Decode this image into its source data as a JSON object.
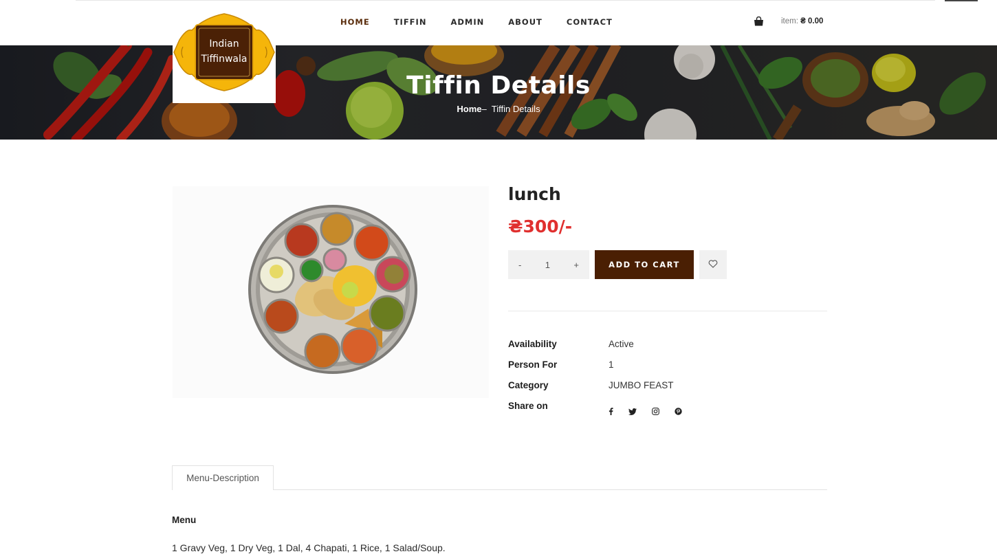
{
  "nav": {
    "items": [
      {
        "label": "HOME"
      },
      {
        "label": "TIFFIN"
      },
      {
        "label": "ADMIN"
      },
      {
        "label": "ABOUT"
      },
      {
        "label": "CONTACT"
      }
    ]
  },
  "cart": {
    "item_label": "item:",
    "amount": "₴ 0.00",
    "icon": "shopping-bag-icon"
  },
  "logo": {
    "line1": "Indian",
    "line2": "Tiffinwala"
  },
  "banner": {
    "title": "Tiffin Details",
    "crumb_home": "Home",
    "crumb_sep": "–",
    "crumb_current": "Tiffin Details"
  },
  "product": {
    "name": "lunch",
    "price": "₴300/-",
    "qty_minus": "-",
    "qty_value": "1",
    "qty_plus": "+",
    "add_to_cart": "ADD TO CART",
    "wishlist_icon": "heart-icon"
  },
  "details": {
    "availability_label": "Availability",
    "availability_value": "Active",
    "person_label": "Person For",
    "person_value": "1",
    "category_label": "Category",
    "category_value": "JUMBO FEAST",
    "share_label": "Share on",
    "share_icons": [
      "facebook-icon",
      "twitter-icon",
      "instagram-icon",
      "pinterest-icon"
    ]
  },
  "tabs": {
    "menu_description": "Menu-Description"
  },
  "menu": {
    "heading": "Menu",
    "text": "1 Gravy Veg, 1 Dry Veg, 1 Dal, 4 Chapati, 1 Rice, 1 Salad/Soup."
  },
  "colors": {
    "accent_brown": "#4a1f03",
    "price_red": "#e0302f",
    "logo_yellow": "#f5b50a",
    "logo_brown": "#4b2106"
  }
}
